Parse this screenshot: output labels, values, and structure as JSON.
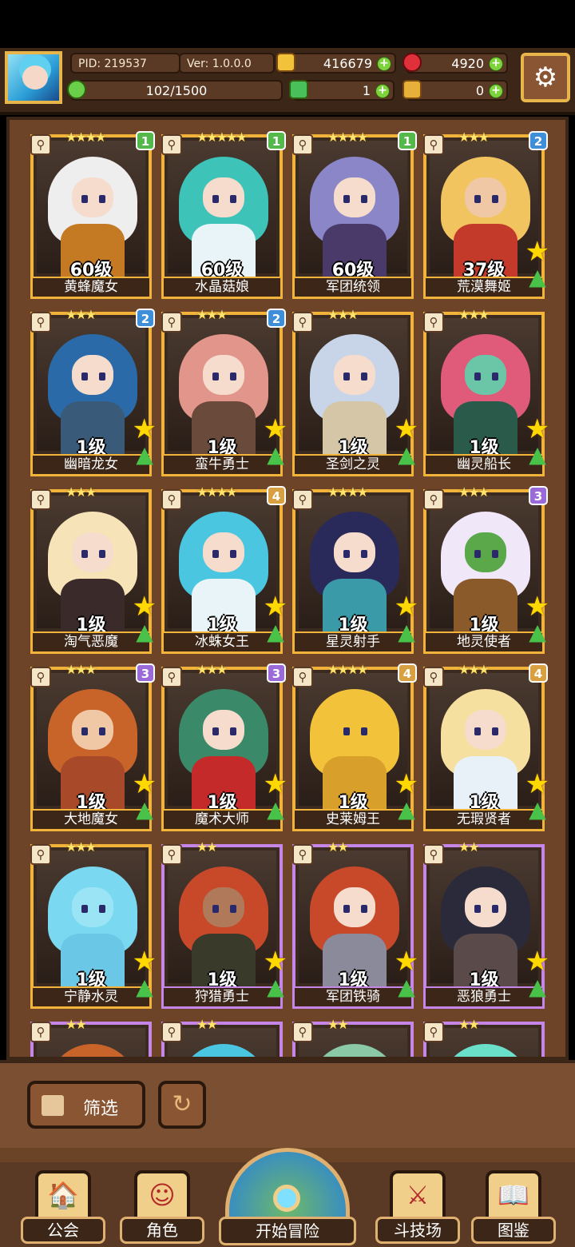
{
  "header": {
    "pid": "PID: 219537",
    "ver": "Ver: 1.0.0.0",
    "gold": "416679",
    "gems": "4920",
    "stamina": "102/1500",
    "clover": "1",
    "keys": "0"
  },
  "toolbar": {
    "filter_label": "筛选"
  },
  "nav": {
    "guild": "公会",
    "role": "角色",
    "adventure": "开始冒险",
    "arena": "斗技场",
    "codex": "图鉴"
  },
  "cards": [
    {
      "name": "黄蜂魔女",
      "level": "60级",
      "badge": "1",
      "stars": "★★★★",
      "badge_color": "#55b84a",
      "hair": "#eeeeee",
      "face": "#f6dccc",
      "body": "#c47a22",
      "frame": "gold"
    },
    {
      "name": "水晶菇娘",
      "level": "60级",
      "badge": "1",
      "stars": "★★★★★",
      "badge_color": "#55b84a",
      "hair": "#3ec3b8",
      "face": "#f6dccc",
      "body": "#e8f4f8",
      "frame": "gold"
    },
    {
      "name": "军团统领",
      "level": "60级",
      "badge": "1",
      "stars": "★★★★",
      "badge_color": "#55b84a",
      "hair": "#8a86c8",
      "face": "#f6dccc",
      "body": "#4a3a6a",
      "frame": "gold"
    },
    {
      "name": "荒漠舞姬",
      "level": "37级",
      "badge": "2",
      "stars": "★★★",
      "badge_color": "#3f8fd8",
      "hair": "#f2c460",
      "face": "#f0c8a6",
      "body": "#c43a2a",
      "frame": "gold"
    },
    {
      "name": "幽暗龙女",
      "level": "1级",
      "badge": "2",
      "stars": "★★★",
      "badge_color": "#3f8fd8",
      "hair": "#2a6aa8",
      "face": "#f6dccc",
      "body": "#3a5a7a",
      "frame": "gold"
    },
    {
      "name": "蛮牛勇士",
      "level": "1级",
      "badge": "2",
      "stars": "★★★",
      "badge_color": "#3f8fd8",
      "hair": "#e2958a",
      "face": "#f6dccc",
      "body": "#6a4a3a",
      "frame": "gold"
    },
    {
      "name": "圣剑之灵",
      "level": "1级",
      "badge": "",
      "stars": "★★★",
      "badge_color": "",
      "hair": "#c8d4e8",
      "face": "#f6dccc",
      "body": "#d6c6a8",
      "frame": "gold"
    },
    {
      "name": "幽灵船长",
      "level": "1级",
      "badge": "",
      "stars": "★★★",
      "badge_color": "",
      "hair": "#e05a7a",
      "face": "#6ac6a6",
      "body": "#2a5a4a",
      "frame": "gold"
    },
    {
      "name": "淘气恶魔",
      "level": "1级",
      "badge": "",
      "stars": "★★★",
      "badge_color": "",
      "hair": "#f6e4b8",
      "face": "#f6dccc",
      "body": "#3a2a2a",
      "frame": "gold"
    },
    {
      "name": "冰蛛女王",
      "level": "1级",
      "badge": "4",
      "stars": "★★★★",
      "badge_color": "#d8a040",
      "hair": "#4ac6e0",
      "face": "#f6dccc",
      "body": "#e8f4f8",
      "frame": "gold"
    },
    {
      "name": "星灵射手",
      "level": "1级",
      "badge": "",
      "stars": "★★★★",
      "badge_color": "",
      "hair": "#2a2a5a",
      "face": "#f6dccc",
      "body": "#3a9aa8",
      "frame": "gold"
    },
    {
      "name": "地灵使者",
      "level": "1级",
      "badge": "3",
      "stars": "★★★",
      "badge_color": "#9a6ad8",
      "hair": "#f0e8f8",
      "face": "#5aa84a",
      "body": "#8a5a2a",
      "frame": "gold"
    },
    {
      "name": "大地魔女",
      "level": "1级",
      "badge": "3",
      "stars": "★★★",
      "badge_color": "#9a6ad8",
      "hair": "#c8642a",
      "face": "#f0c8a6",
      "body": "#a84a2a",
      "frame": "gold"
    },
    {
      "name": "魔术大师",
      "level": "1级",
      "badge": "3",
      "stars": "★★★",
      "badge_color": "#9a6ad8",
      "hair": "#3a8a6a",
      "face": "#f6dccc",
      "body": "#c42a2a",
      "frame": "gold"
    },
    {
      "name": "史莱姆王",
      "level": "1级",
      "badge": "4",
      "stars": "★★★★",
      "badge_color": "#d8a040",
      "hair": "#f2c23a",
      "face": "#f2c23a",
      "body": "#d8a02a",
      "frame": "gold"
    },
    {
      "name": "无瑕贤者",
      "level": "1级",
      "badge": "4",
      "stars": "★★★",
      "badge_color": "#d8a040",
      "hair": "#f6e0a0",
      "face": "#f6dccc",
      "body": "#e8f0f8",
      "frame": "gold"
    },
    {
      "name": "宁静水灵",
      "level": "1级",
      "badge": "",
      "stars": "★★★",
      "badge_color": "",
      "hair": "#7ad8f0",
      "face": "#9ae4f6",
      "body": "#6ac8e6",
      "frame": "gold"
    },
    {
      "name": "狩猎勇士",
      "level": "1级",
      "badge": "",
      "stars": "★★",
      "badge_color": "",
      "hair": "#c8482a",
      "face": "#b07a5a",
      "body": "#3a3a2a",
      "frame": "purple"
    },
    {
      "name": "军团铁骑",
      "level": "1级",
      "badge": "",
      "stars": "★★",
      "badge_color": "",
      "hair": "#c8482a",
      "face": "#f6dccc",
      "body": "#8a8a9a",
      "frame": "purple"
    },
    {
      "name": "恶狼勇士",
      "level": "1级",
      "badge": "",
      "stars": "★★",
      "badge_color": "",
      "hair": "#2a2a3a",
      "face": "#f6dccc",
      "body": "#5a4a4a",
      "frame": "purple"
    },
    {
      "name": "",
      "level": "",
      "badge": "",
      "stars": "★★",
      "badge_color": "",
      "hair": "#c8642a",
      "face": "#f6dccc",
      "body": "#5a3a2a",
      "frame": "purple"
    },
    {
      "name": "",
      "level": "",
      "badge": "",
      "stars": "★★",
      "badge_color": "",
      "hair": "#4ac6e0",
      "face": "#f6dccc",
      "body": "#5a3a2a",
      "frame": "purple"
    },
    {
      "name": "",
      "level": "",
      "badge": "",
      "stars": "★★",
      "badge_color": "",
      "hair": "#8ac8a6",
      "face": "#f6dccc",
      "body": "#5a3a2a",
      "frame": "purple"
    },
    {
      "name": "",
      "level": "",
      "badge": "",
      "stars": "★★",
      "badge_color": "",
      "hair": "#6ae0c8",
      "face": "#f6dccc",
      "body": "#5a3a2a",
      "frame": "purple"
    }
  ]
}
